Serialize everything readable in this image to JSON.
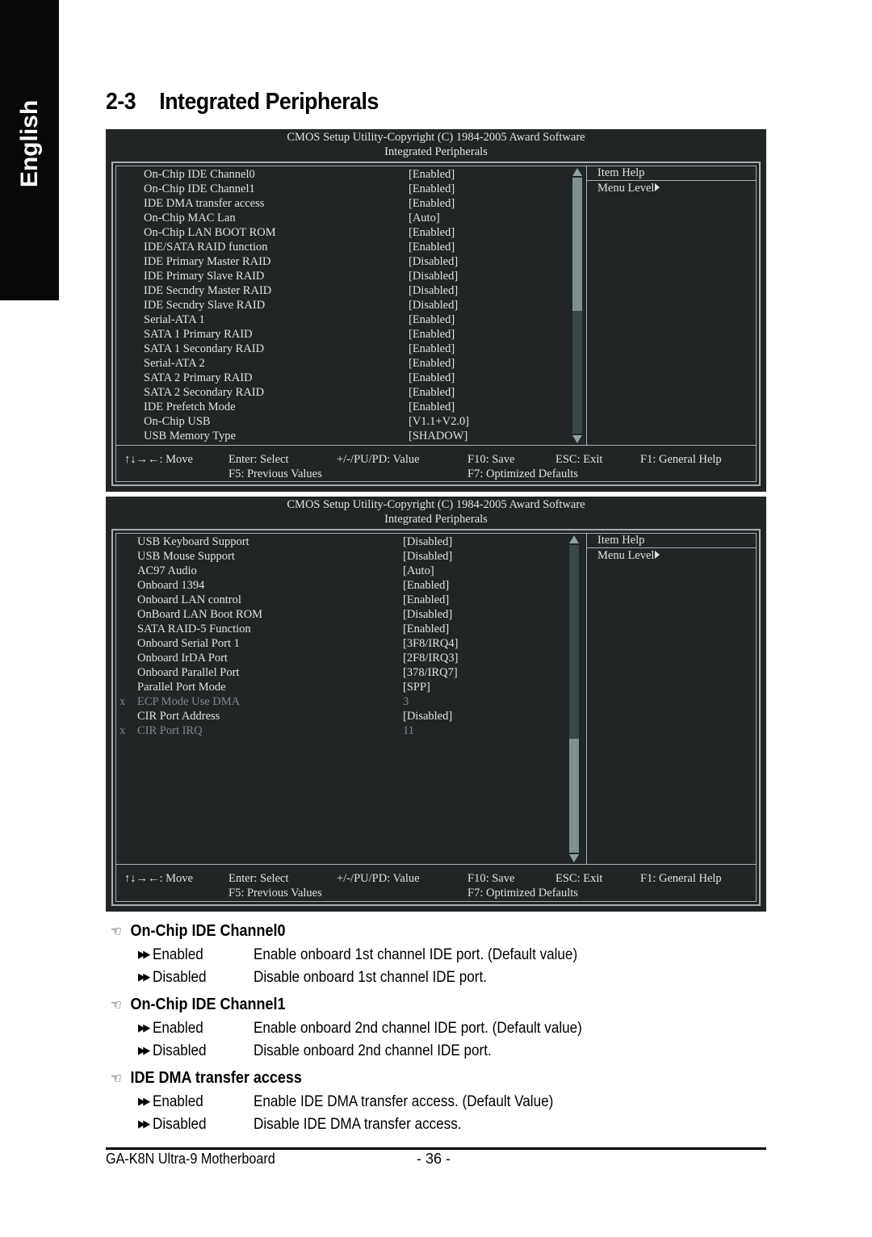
{
  "side_tab": {
    "label": "English"
  },
  "section": {
    "number": "2-3",
    "title": "Integrated Peripherals"
  },
  "panels": [
    {
      "header_line1": "CMOS Setup Utility-Copyright (C) 1984-2005 Award Software",
      "header_line2": "Integrated Peripherals",
      "help_title": "Item Help",
      "help_level": "Menu Level",
      "scroll_position": {
        "thumb_start": 0.0,
        "thumb_end": 0.52
      },
      "items": [
        {
          "label": "On-Chip IDE Channel0",
          "value": "[Enabled]",
          "disabled": false
        },
        {
          "label": "On-Chip IDE Channel1",
          "value": "[Enabled]",
          "disabled": false
        },
        {
          "label": "IDE DMA transfer access",
          "value": "[Enabled]",
          "disabled": false
        },
        {
          "label": "On-Chip MAC Lan",
          "value": "[Auto]",
          "disabled": false
        },
        {
          "label": "On-Chip LAN BOOT ROM",
          "value": "[Enabled]",
          "disabled": false
        },
        {
          "label": "IDE/SATA RAID function",
          "value": "[Enabled]",
          "disabled": false
        },
        {
          "label": "IDE Primary Master RAID",
          "value": "[Disabled]",
          "disabled": false
        },
        {
          "label": "IDE Primary Slave RAID",
          "value": "[Disabled]",
          "disabled": false
        },
        {
          "label": "IDE Secndry Master RAID",
          "value": "[Disabled]",
          "disabled": false
        },
        {
          "label": "IDE Secndry Slave RAID",
          "value": "[Disabled]",
          "disabled": false
        },
        {
          "label": "Serial-ATA 1",
          "value": "[Enabled]",
          "disabled": false
        },
        {
          "label": "SATA 1 Primary RAID",
          "value": "[Enabled]",
          "disabled": false
        },
        {
          "label": "SATA 1 Secondary RAID",
          "value": "[Enabled]",
          "disabled": false
        },
        {
          "label": "Serial-ATA 2",
          "value": "[Enabled]",
          "disabled": false
        },
        {
          "label": "SATA 2 Primary RAID",
          "value": "[Enabled]",
          "disabled": false
        },
        {
          "label": "SATA 2 Secondary RAID",
          "value": "[Enabled]",
          "disabled": false
        },
        {
          "label": "IDE Prefetch Mode",
          "value": "[Enabled]",
          "disabled": false
        },
        {
          "label": "On-Chip USB",
          "value": "[V1.1+V2.0]",
          "disabled": false
        },
        {
          "label": "USB Memory Type",
          "value": "[SHADOW]",
          "disabled": false
        }
      ]
    },
    {
      "header_line1": "CMOS Setup Utility-Copyright (C) 1984-2005 Award Software",
      "header_line2": "Integrated Peripherals",
      "help_title": "Item Help",
      "help_level": "Menu Level",
      "scroll_position": {
        "thumb_start": 0.63,
        "thumb_end": 1.0
      },
      "items": [
        {
          "label": "USB Keyboard Support",
          "value": "[Disabled]",
          "disabled": false
        },
        {
          "label": "USB Mouse Support",
          "value": "[Disabled]",
          "disabled": false
        },
        {
          "label": "AC97 Audio",
          "value": "[Auto]",
          "disabled": false
        },
        {
          "label": "Onboard 1394",
          "value": "[Enabled]",
          "disabled": false
        },
        {
          "label": "Onboard LAN control",
          "value": "[Enabled]",
          "disabled": false
        },
        {
          "label": "OnBoard LAN Boot ROM",
          "value": "[Disabled]",
          "disabled": false
        },
        {
          "label": "SATA RAID-5 Function",
          "value": "[Enabled]",
          "disabled": false
        },
        {
          "label": "Onboard Serial Port 1",
          "value": "[3F8/IRQ4]",
          "disabled": false
        },
        {
          "label": "Onboard IrDA Port",
          "value": "[2F8/IRQ3]",
          "disabled": false
        },
        {
          "label": "Onboard Parallel Port",
          "value": "[378/IRQ7]",
          "disabled": false
        },
        {
          "label": "Parallel Port Mode",
          "value": "[SPP]",
          "disabled": false
        },
        {
          "label": "ECP Mode Use DMA",
          "value": "3",
          "disabled": true,
          "marker": "x"
        },
        {
          "label": "CIR Port Address",
          "value": "[Disabled]",
          "disabled": false
        },
        {
          "label": "CIR Port IRQ",
          "value": "11",
          "disabled": true,
          "marker": "x"
        }
      ]
    }
  ],
  "bios_footer": {
    "move": "↑↓→←: Move",
    "select": "Enter: Select",
    "value": "+/-/PU/PD: Value",
    "save": "F10: Save",
    "exit": "ESC: Exit",
    "help": "F1: General Help",
    "previous": "F5: Previous Values",
    "defaults": "F7: Optimized Defaults"
  },
  "options": [
    {
      "title": "On-Chip IDE Channel0",
      "choices": [
        {
          "key": "Enabled",
          "desc": "Enable onboard 1st channel IDE port. (Default value)"
        },
        {
          "key": "Disabled",
          "desc": "Disable onboard 1st channel IDE port."
        }
      ]
    },
    {
      "title": "On-Chip IDE Channel1",
      "choices": [
        {
          "key": "Enabled",
          "desc": "Enable onboard 2nd channel IDE port. (Default value)"
        },
        {
          "key": "Disabled",
          "desc": "Disable onboard 2nd channel IDE port."
        }
      ]
    },
    {
      "title": "IDE DMA transfer access",
      "choices": [
        {
          "key": "Enabled",
          "desc": "Enable IDE DMA transfer access. (Default Value)"
        },
        {
          "key": "Disabled",
          "desc": "Disable IDE DMA transfer access."
        }
      ]
    }
  ],
  "icons": {
    "heading": "pointing-hand-icon",
    "bullet": "double-arrow-icon"
  },
  "page_footer": {
    "product": "GA-K8N Ultra-9 Motherboard",
    "page": "- 36 -"
  },
  "colors": {
    "bios_bg": "#222526",
    "bios_text": "#dfe3e3",
    "bios_border": "#a7b0b0",
    "bios_dim": "#7e8888",
    "scroll_thumb": "#7e9090",
    "scroll_track": "#3a4747",
    "tab_bg": "#070808"
  }
}
